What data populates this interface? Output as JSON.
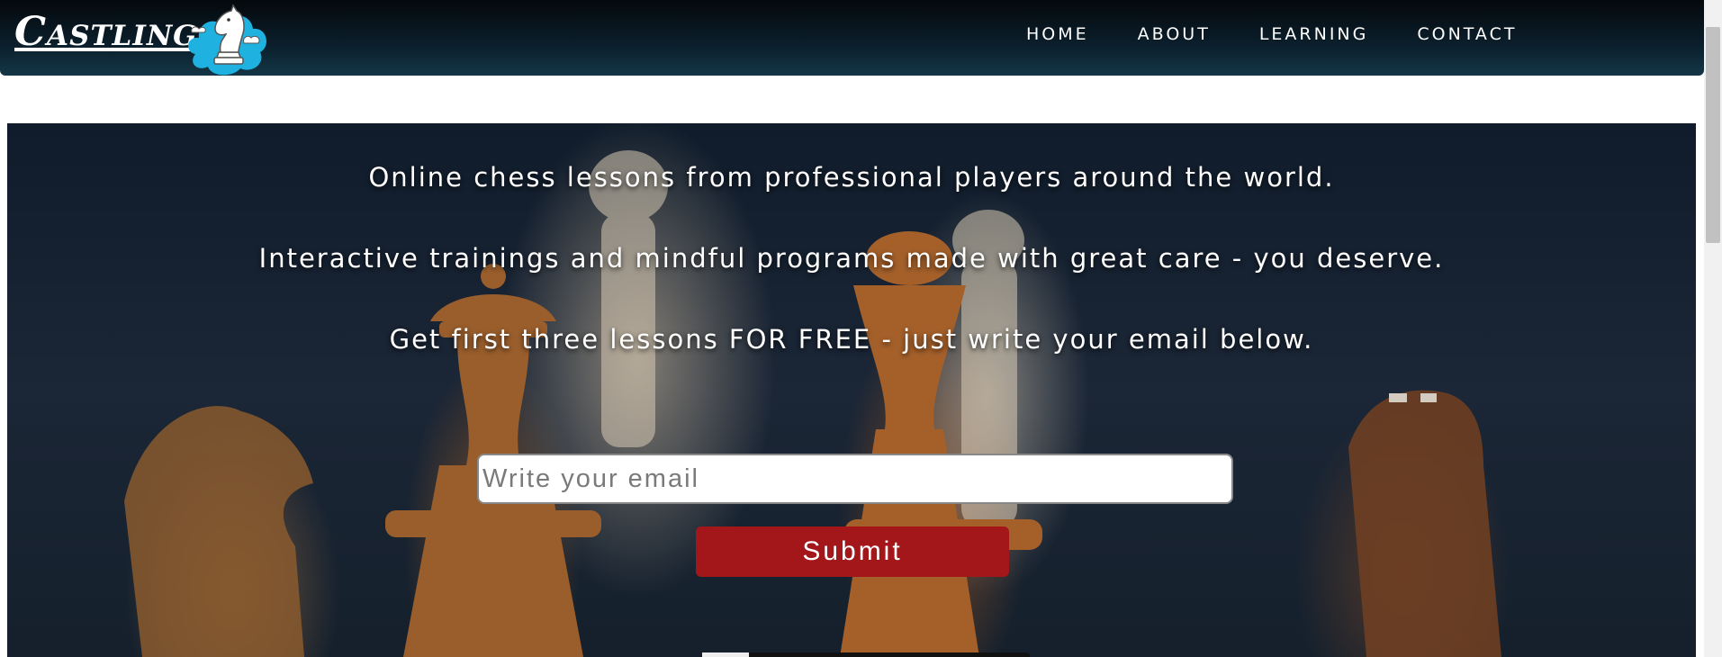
{
  "header": {
    "logo_text": "Castling",
    "nav": [
      {
        "label": "HOME"
      },
      {
        "label": "ABOUT"
      },
      {
        "label": "LEARNING"
      },
      {
        "label": "CONTACT"
      }
    ]
  },
  "hero": {
    "lines": [
      "Online chess lessons from professional players around the world.",
      "Interactive trainings and mindful programs made with great care - you deserve.",
      "Get first three lessons FOR FREE - just write your email below."
    ],
    "email_placeholder": "Write your email",
    "email_value": "",
    "submit_label": "Submit"
  },
  "colors": {
    "nav_bg": "#0b1f2c",
    "accent_button": "#a3161a",
    "logo_cloud": "#1fb2e0"
  },
  "icons": {
    "logo": "knight-cloud-icon"
  }
}
